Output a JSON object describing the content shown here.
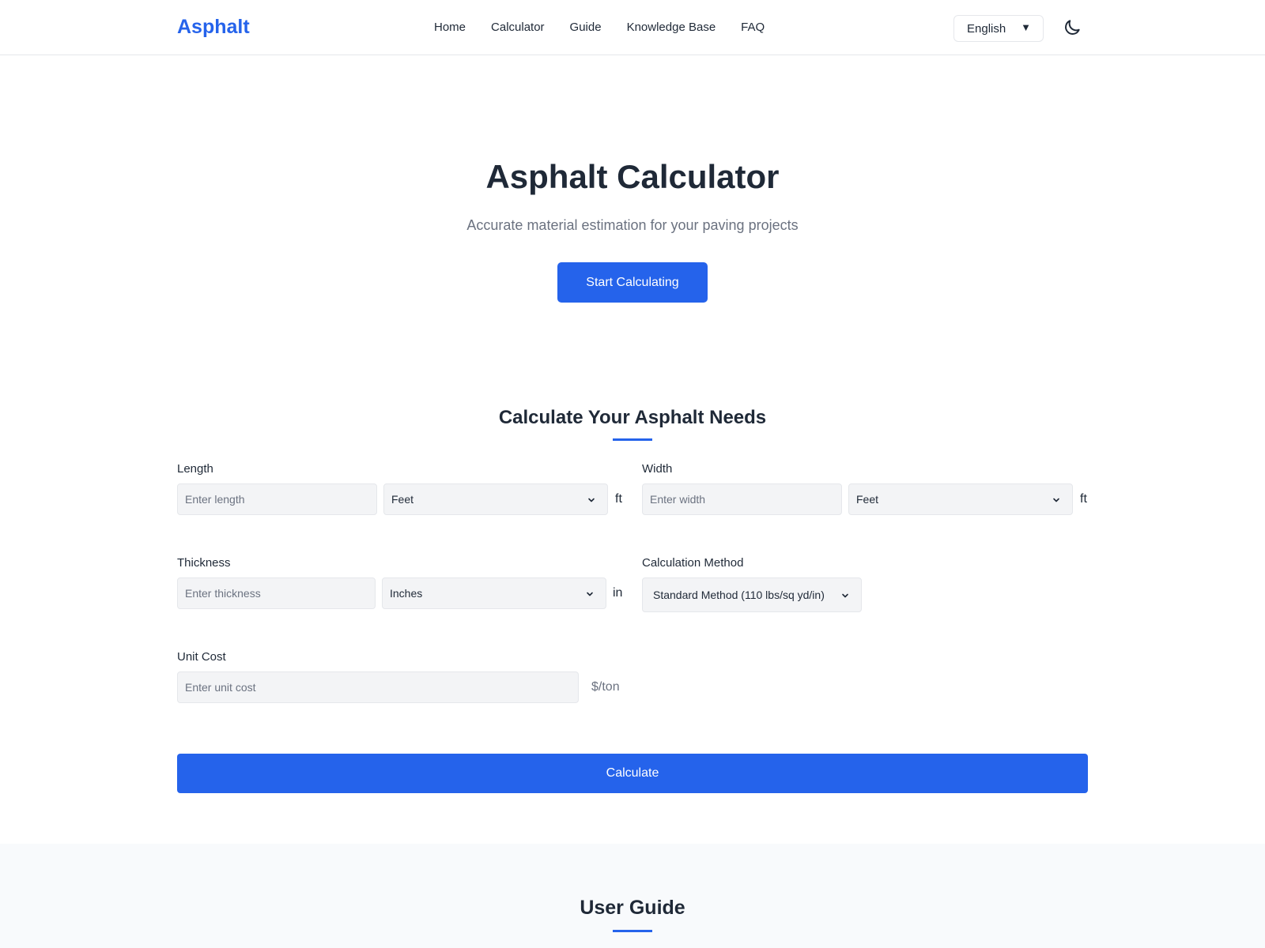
{
  "header": {
    "logo": "Asphalt",
    "nav": [
      "Home",
      "Calculator",
      "Guide",
      "Knowledge Base",
      "FAQ"
    ],
    "language": "English",
    "language_arrow": "▼",
    "theme_icon": "moon-icon"
  },
  "hero": {
    "title": "Asphalt Calculator",
    "subtitle": "Accurate material estimation for your paving projects",
    "button": "Start Calculating"
  },
  "calculator": {
    "title": "Calculate Your Asphalt Needs",
    "length": {
      "label": "Length",
      "placeholder": "Enter length",
      "unit_select": "Feet",
      "unit": "ft"
    },
    "width": {
      "label": "Width",
      "placeholder": "Enter width",
      "unit_select": "Feet",
      "unit": "ft"
    },
    "thickness": {
      "label": "Thickness",
      "placeholder": "Enter thickness",
      "unit_select": "Inches",
      "unit": "in"
    },
    "method": {
      "label": "Calculation Method",
      "value": "Standard Method (110 lbs/sq yd/in)"
    },
    "unit_cost": {
      "label": "Unit Cost",
      "placeholder": "Enter unit cost",
      "unit": "$/ton"
    },
    "calculate_button": "Calculate"
  },
  "guide": {
    "title": "User Guide"
  },
  "colors": {
    "accent": "#2563eb",
    "text": "#1f2937",
    "muted": "#6b7280",
    "field_bg": "#f3f4f6"
  }
}
